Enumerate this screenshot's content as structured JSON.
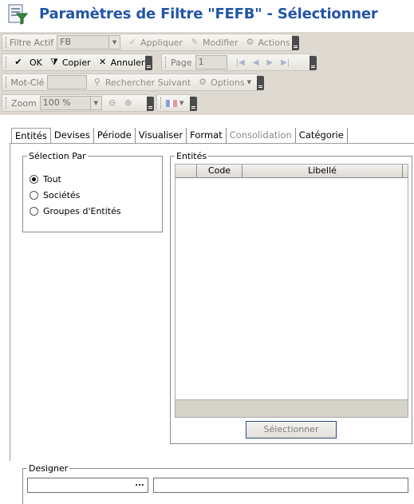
{
  "header": {
    "title": "Paramètres de Filtre \"FEFB\" - Sélectionner"
  },
  "toolbar_filter": {
    "label": "Filtre Actif",
    "value": "FB",
    "apply_label": "Appliquer",
    "modify_label": "Modifier",
    "actions_label": "Actions"
  },
  "toolbar_actions": {
    "ok_label": "OK",
    "copy_label": "Copier",
    "cancel_label": "Annuler",
    "page_label": "Page",
    "page_value": "1"
  },
  "toolbar_search": {
    "keyword_label": "Mot-Clé",
    "keyword_value": "",
    "find_next_label": "Rechercher Suivant",
    "options_label": "Options"
  },
  "toolbar_zoom": {
    "zoom_label": "Zoom",
    "zoom_value": "100 %"
  },
  "tabs": [
    {
      "label": "Entités"
    },
    {
      "label": "Devises"
    },
    {
      "label": "Période"
    },
    {
      "label": "Visualiser"
    },
    {
      "label": "Format"
    },
    {
      "label": "Consolidation"
    },
    {
      "label": "Catégorie"
    }
  ],
  "selection": {
    "legend": "Sélection Par",
    "options": [
      {
        "label": "Tout",
        "checked": true
      },
      {
        "label": "Sociétés",
        "checked": false
      },
      {
        "label": "Groupes d'Entités",
        "checked": false
      }
    ]
  },
  "entities": {
    "legend": "Entités",
    "columns": [
      "Code",
      "Libellé"
    ],
    "select_label": "Sélectionner"
  },
  "designer": {
    "legend": "Designer",
    "ellipsis_label": "...",
    "code_value": "",
    "name_value": ""
  },
  "colors": {
    "title": "#2355a8",
    "toolbar_bg": "#dedad2",
    "grid_footer": "#d5d2ca"
  }
}
